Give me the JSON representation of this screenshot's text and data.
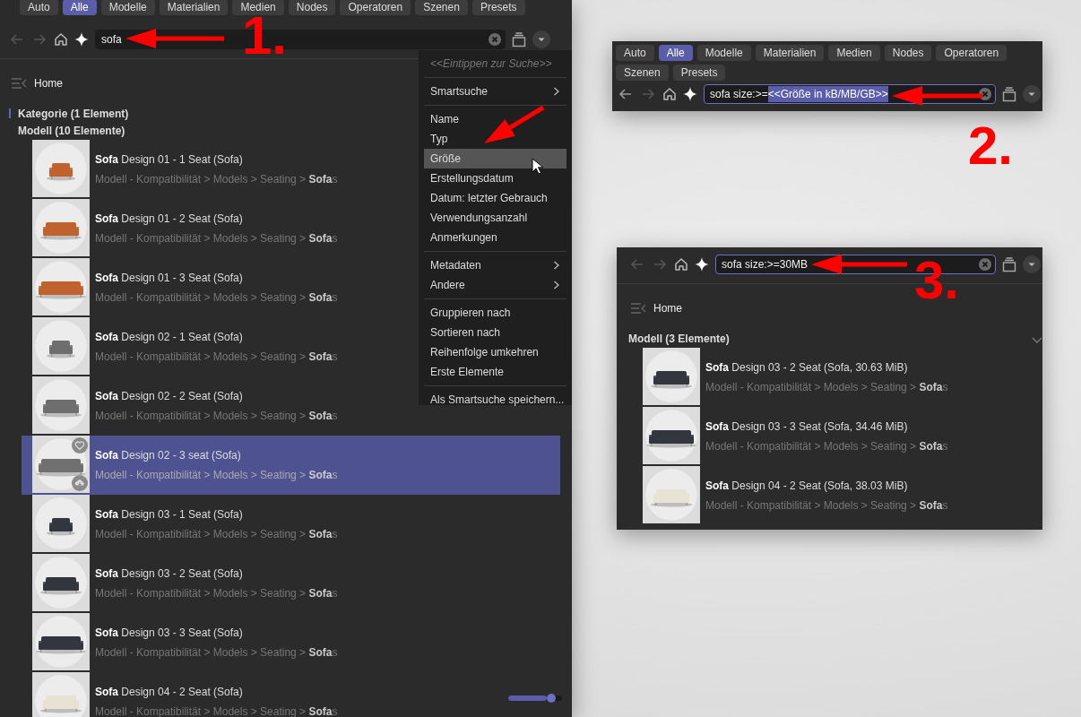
{
  "main": {
    "filter_tabs": [
      {
        "label": "Auto",
        "selected": false
      },
      {
        "label": "Alle",
        "selected": true
      },
      {
        "label": "Modelle",
        "selected": false
      },
      {
        "label": "Materialien",
        "selected": false
      },
      {
        "label": "Medien",
        "selected": false
      },
      {
        "label": "Nodes",
        "selected": false
      },
      {
        "label": "Operatoren",
        "selected": false
      },
      {
        "label": "Szenen",
        "selected": false
      },
      {
        "label": "Presets",
        "selected": false
      }
    ],
    "nav": [
      {
        "kind": "back",
        "disabled": true
      },
      {
        "kind": "forward",
        "disabled": true
      }
    ],
    "search": {
      "value": "sofa",
      "focused": false
    },
    "breadcrumb": "Home",
    "groups": [
      {
        "title": "Kategorie (1 Element)",
        "marked": true
      },
      {
        "title": "Modell (10 Elemente)",
        "items": [
          {
            "name": "**Sofa** Design 01 - 1 Seat (Sofa)",
            "path": "Modell - Kompatibilität > Models > Seating > **Sofa**s",
            "selected": false
          },
          {
            "name": "**Sofa** Design 01 - 2 Seat (Sofa)",
            "path": "Modell - Kompatibilität > Models > Seating > **Sofa**s",
            "selected": false
          },
          {
            "name": "**Sofa** Design 01 - 3 Seat (Sofa)",
            "path": "Modell - Kompatibilität > Models > Seating > **Sofa**s",
            "selected": false
          },
          {
            "name": "**Sofa** Design 02 - 1 Seat (Sofa)",
            "path": "Modell - Kompatibilität > Models > Seating > **Sofa**s",
            "selected": false
          },
          {
            "name": "**Sofa** Design 02 - 2 Seat (Sofa)",
            "path": "Modell - Kompatibilität > Models > Seating > **Sofa**s",
            "selected": false
          },
          {
            "name": "**Sofa** Design 02 - 3 seat (Sofa)",
            "path": "Modell - Kompatibilität > Models > Seating > **Sofa**s",
            "selected": true
          },
          {
            "name": "**Sofa** Design 03 - 1 Seat (Sofa)",
            "path": "Modell - Kompatibilität > Models > Seating > **Sofa**s",
            "selected": false
          },
          {
            "name": "**Sofa** Design 03 - 2 Seat (Sofa)",
            "path": "Modell - Kompatibilität > Models > Seating > **Sofa**s",
            "selected": false
          },
          {
            "name": "**Sofa** Design 03 - 3 Seat (Sofa)",
            "path": "Modell - Kompatibilität > Models > Seating > **Sofa**s",
            "selected": false
          },
          {
            "name": "**Sofa** Design 04 - 2 Seat (Sofa)",
            "path": "Modell - Kompatibilität > Models > Seating > **Sofa**s",
            "selected": false
          }
        ]
      }
    ],
    "menu": {
      "hint": "<<Eintippen zur Suche>>",
      "sections": [
        {
          "items": [
            {
              "label": "Smartsuche",
              "submenu": true,
              "highlighted": false
            }
          ]
        },
        {
          "items": [
            {
              "label": "Name",
              "submenu": false,
              "highlighted": false
            },
            {
              "label": "Typ",
              "submenu": false,
              "highlighted": false
            },
            {
              "label": "Größe",
              "submenu": false,
              "highlighted": true
            },
            {
              "label": "Erstellungsdatum",
              "submenu": false,
              "highlighted": false
            },
            {
              "label": "Datum: letzter Gebrauch",
              "submenu": false,
              "highlighted": false
            },
            {
              "label": "Verwendungsanzahl",
              "submenu": false,
              "highlighted": false
            },
            {
              "label": "Anmerkungen",
              "submenu": false,
              "highlighted": false
            }
          ]
        },
        {
          "items": [
            {
              "label": "Metadaten",
              "submenu": true,
              "highlighted": false
            },
            {
              "label": "Andere",
              "submenu": true,
              "highlighted": false
            }
          ]
        },
        {
          "items": [
            {
              "label": "Gruppieren nach",
              "submenu": false,
              "highlighted": false
            },
            {
              "label": "Sortieren nach",
              "submenu": false,
              "highlighted": false
            },
            {
              "label": "Reihenfolge umkehren",
              "submenu": false,
              "highlighted": false
            },
            {
              "label": "Erste Elemente",
              "submenu": false,
              "highlighted": false
            }
          ]
        },
        {
          "items": [
            {
              "label": "Als Smartsuche speichern...",
              "submenu": false,
              "highlighted": false
            }
          ]
        }
      ]
    },
    "zoom_slider": {
      "level": 0.72
    }
  },
  "prompt_panel": {
    "filter_tabs": [
      {
        "label": "Auto",
        "selected": false
      },
      {
        "label": "Alle",
        "selected": true
      },
      {
        "label": "Modelle",
        "selected": false
      },
      {
        "label": "Materialien",
        "selected": false
      },
      {
        "label": "Medien",
        "selected": false
      },
      {
        "label": "Nodes",
        "selected": false
      },
      {
        "label": "Operatoren",
        "selected": false
      },
      {
        "label": "Szenen",
        "selected": false
      },
      {
        "label": "Presets",
        "selected": false
      }
    ],
    "nav": [
      {
        "kind": "back",
        "disabled": false
      },
      {
        "kind": "forward",
        "disabled": true
      }
    ],
    "search": {
      "value": "sofa size:>=",
      "selection": "<<Größe in kB/MB/GB>>",
      "focused": true
    }
  },
  "result_panel": {
    "nav": [
      {
        "kind": "back",
        "disabled": true
      },
      {
        "kind": "forward",
        "disabled": true
      }
    ],
    "search": {
      "value": "sofa size:>=30MB",
      "focused": true
    },
    "breadcrumb": "Home",
    "groups": [
      {
        "title": "Modell (3 Elemente)",
        "expanded": true,
        "items": [
          {
            "name": "**Sofa** Design 03 - 2 Seat (Sofa, 30.63 MiB)",
            "path": "Modell - Kompatibilität > Models > Seating > **Sofa**s",
            "selected": false
          },
          {
            "name": "**Sofa** Design 03 - 3 Seat (Sofa, 34.46 MiB)",
            "path": "Modell - Kompatibilität > Models > Seating > **Sofa**s",
            "selected": false
          },
          {
            "name": "**Sofa** Design 04 - 2 Seat (Sofa, 38.03 MiB)",
            "path": "Modell - Kompatibilität > Models > Seating > **Sofa**s",
            "selected": false
          }
        ]
      }
    ]
  },
  "annotations": [
    {
      "label": "1."
    },
    {
      "label": "2."
    },
    {
      "label": "3."
    }
  ]
}
